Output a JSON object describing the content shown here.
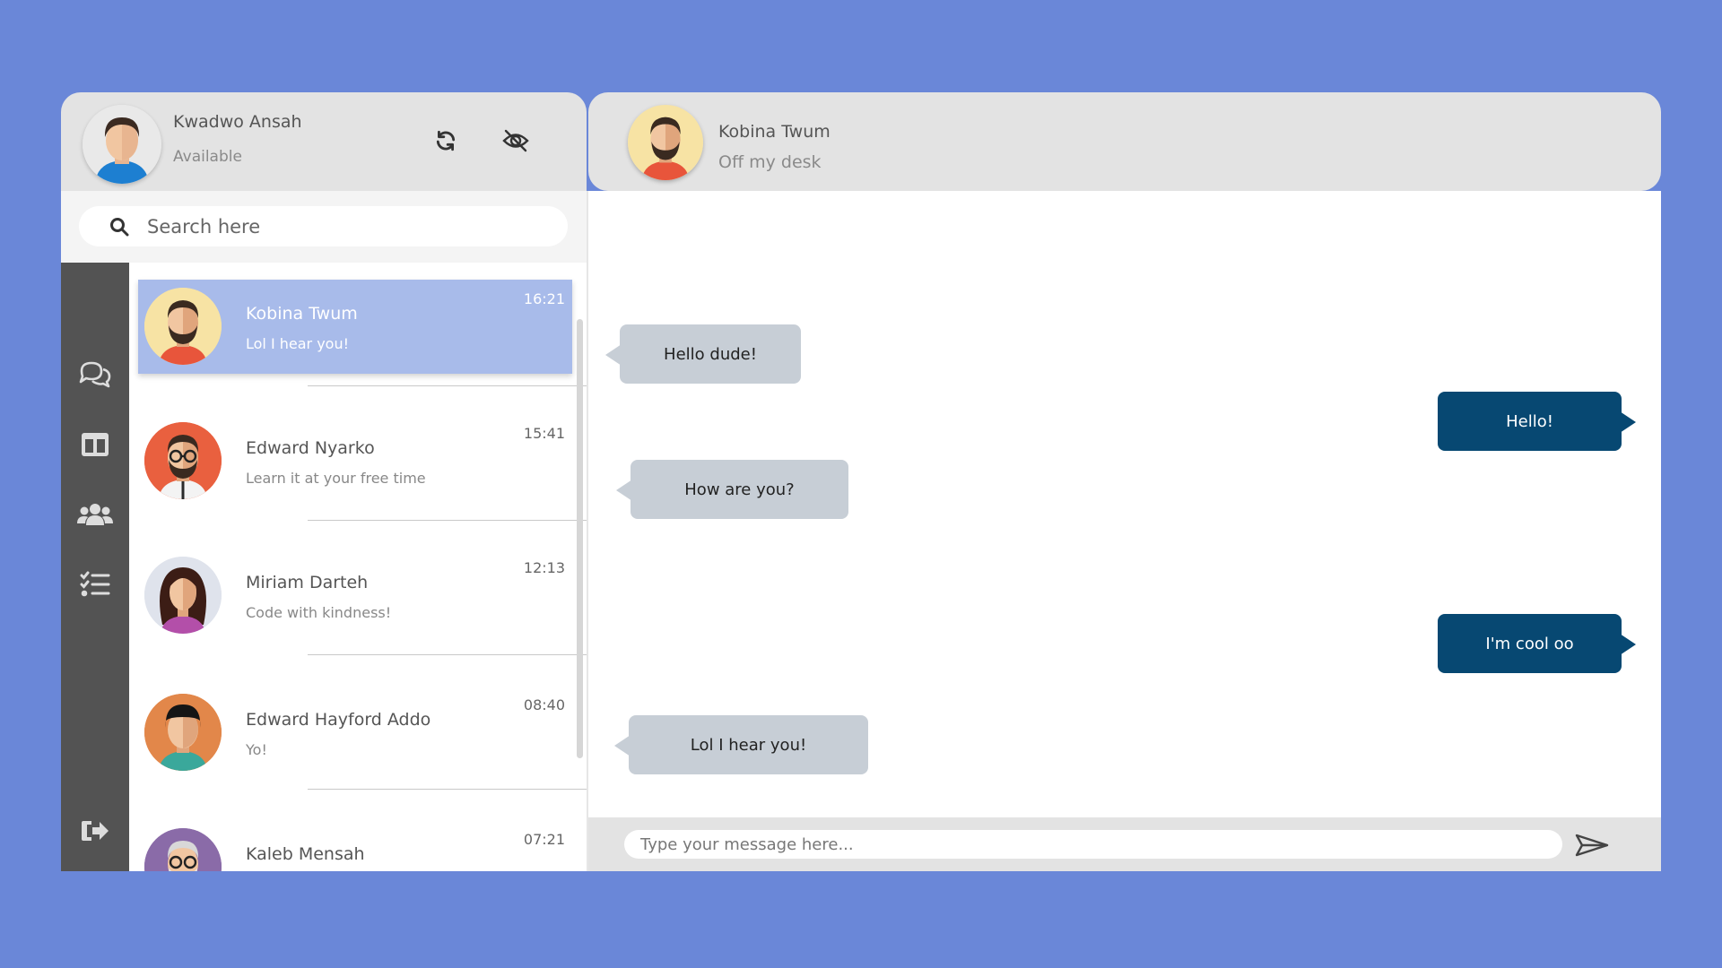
{
  "me": {
    "name": "Kwadwo Ansah",
    "status": "Available"
  },
  "icons": {
    "refresh": "refresh-icon",
    "hide": "eye-slash-icon",
    "search": "search-icon",
    "chats": "chat-bubbles-icon",
    "layout": "columns-icon",
    "groups": "users-icon",
    "tasks": "task-list-icon",
    "logout": "sign-out-icon",
    "send": "paper-plane-icon"
  },
  "search": {
    "placeholder": "Search here"
  },
  "contacts": [
    {
      "name": "Kobina Twum",
      "last_message": "Lol I hear you!",
      "time": "16:21",
      "active": true
    },
    {
      "name": "Edward Nyarko",
      "last_message": "Learn it at your free time",
      "time": "15:41"
    },
    {
      "name": "Miriam Darteh",
      "last_message": "Code with kindness!",
      "time": "12:13"
    },
    {
      "name": "Edward Hayford Addo",
      "last_message": "Yo!",
      "time": "08:40"
    },
    {
      "name": "Kaleb Mensah",
      "last_message": "",
      "time": "07:21"
    }
  ],
  "chat": {
    "name": "Kobina Twum",
    "status": "Off my desk",
    "messages": [
      {
        "text": "Hello dude!",
        "direction": "in"
      },
      {
        "text": "Hello!",
        "direction": "out"
      },
      {
        "text": "How are you?",
        "direction": "in"
      },
      {
        "text": "I'm cool oo",
        "direction": "out"
      },
      {
        "text": "Lol I hear you!",
        "direction": "in"
      }
    ]
  },
  "composer": {
    "placeholder": "Type your message here..."
  },
  "colors": {
    "background": "#6a87d8",
    "active_contact": "#a8bbea",
    "incoming_bubble": "#c7ced6",
    "outgoing_bubble": "#074872",
    "sidebar": "#535353"
  }
}
